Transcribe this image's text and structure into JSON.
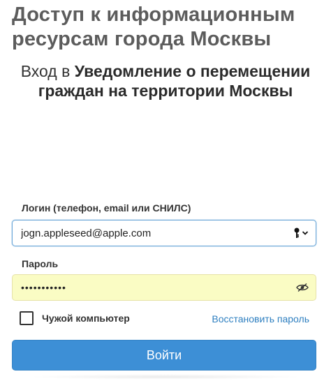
{
  "portal": {
    "title": "Доступ к информационным ресурсам города Москвы"
  },
  "login_heading": {
    "prefix": "Вход в",
    "service": "Уведомление о перемещении граждан на территории Москвы"
  },
  "form": {
    "login_label": "Логин (телефон, email или СНИЛС)",
    "login_value": "jogn.appleseed@apple.com",
    "password_label": "Пароль",
    "password_value": "•••••••••••",
    "foreign_computer_label": "Чужой компьютер",
    "restore_password_link": "Восстановить пароль",
    "submit_label": "Войти"
  },
  "icons": {
    "login_field": "key-icon",
    "login_dropdown": "chevron-down-icon",
    "password_field": "eye-slash-icon"
  },
  "colors": {
    "accent": "#3d8fd6",
    "link": "#2e7fc0",
    "autofill_background": "#fafcc4",
    "title_gray": "#5c5c5c"
  }
}
